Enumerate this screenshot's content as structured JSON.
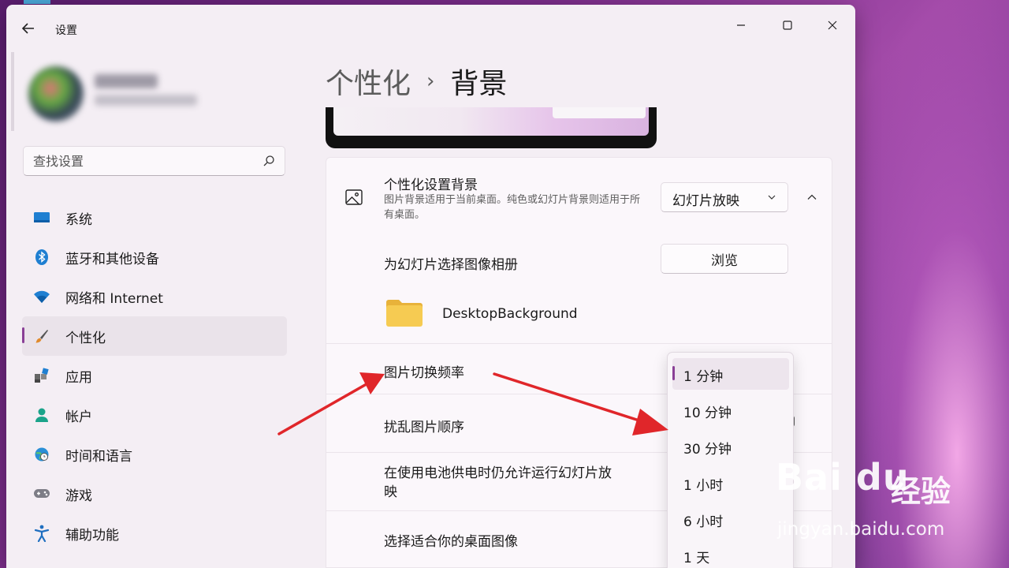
{
  "window": {
    "title": "设置"
  },
  "search": {
    "placeholder": "查找设置"
  },
  "sidebar": {
    "items": [
      {
        "label": "系统"
      },
      {
        "label": "蓝牙和其他设备"
      },
      {
        "label": "网络和 Internet"
      },
      {
        "label": "个性化"
      },
      {
        "label": "应用"
      },
      {
        "label": "帐户"
      },
      {
        "label": "时间和语言"
      },
      {
        "label": "游戏"
      },
      {
        "label": "辅助功能"
      }
    ],
    "active": "个性化"
  },
  "breadcrumb": {
    "parent": "个性化",
    "separator": "›",
    "current": "背景"
  },
  "background_card": {
    "title": "个性化设置背景",
    "description": "图片背景适用于当前桌面。纯色或幻灯片背景则适用于所有桌面。",
    "select_value": "幻灯片放映"
  },
  "rows": {
    "album_label": "为幻灯片选择图像相册",
    "browse_label": "浏览",
    "folder_name": "DesktopBackground",
    "interval_label": "图片切换频率",
    "shuffle_label": "扰乱图片顺序",
    "battery_label": "在使用电池供电时仍允许运行幻灯片放映",
    "fit_label": "选择适合你的桌面图像"
  },
  "interval_dropdown": {
    "options": [
      "1 分钟",
      "10 分钟",
      "30 分钟",
      "1 小时",
      "6 小时",
      "1 天"
    ],
    "selected": "1 分钟"
  },
  "watermark": {
    "logo": "Bai du",
    "suffix": "经验",
    "url": "jingyan.baidu.com"
  },
  "colors": {
    "accent": "#8a3f96",
    "arrow": "#e0262a"
  }
}
